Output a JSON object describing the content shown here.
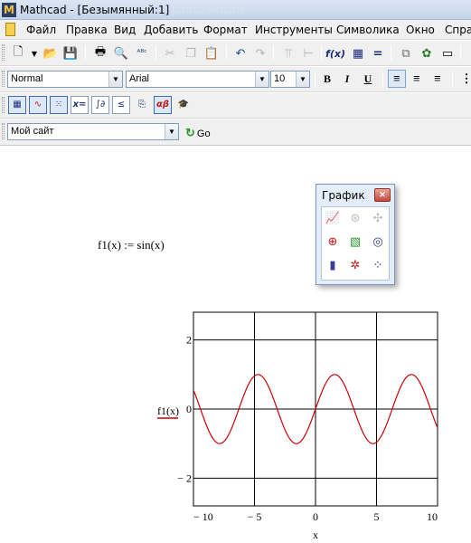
{
  "window": {
    "app_icon_letter": "M",
    "title": "Mathcad - [Безымянный:1]",
    "title_ghost": "Jumaz Amam"
  },
  "menu": {
    "items": [
      "Файл",
      "Правка",
      "Вид",
      "Добавить",
      "Формат",
      "Инструменты",
      "Символика",
      "Окно",
      "Справ"
    ]
  },
  "toolbar_standard": {
    "icons": [
      "new-document",
      "dropdown-arrow",
      "open-folder",
      "save",
      "print",
      "print-preview",
      "spell-check",
      "cut",
      "copy",
      "paste",
      "undo",
      "redo",
      "align-vertical",
      "align-horizontal",
      "insert-function",
      "insert-unit",
      "calculate",
      "resource-center",
      "component-wizard",
      "window"
    ]
  },
  "toolbar_format": {
    "style": "Normal",
    "font": "Arial",
    "size": "10",
    "bold": "B",
    "italic": "I",
    "underline": "U"
  },
  "toolbar_math": {
    "buttons": [
      "calculator",
      "graph",
      "matrix",
      "x=",
      "calculus",
      "boolean",
      "programming",
      "αβ",
      "symbolic"
    ]
  },
  "toolbar_resources": {
    "site": "Мой сайт",
    "go_label": "Go"
  },
  "worksheet": {
    "formula": "f1(x) := sin(x)"
  },
  "graph_palette": {
    "title": "График",
    "buttons": [
      "xy-plot",
      "polar-plot",
      "surface-plot",
      "contour-plot",
      "3d-scatter",
      "vector-field",
      "bar-3d",
      "scatter-3d",
      "patch-plot"
    ]
  },
  "chart_data": {
    "type": "line",
    "function": "sin(x)",
    "series": [
      {
        "name": "f1(x)",
        "color": "#cc0000"
      }
    ],
    "xlabel": "x",
    "ylabel": "f1(x)",
    "xlim": [
      -10,
      10
    ],
    "ylim": [
      -2.8,
      2.8
    ],
    "x_ticks": [
      -10,
      -5,
      0,
      5,
      10
    ],
    "x_tick_labels": [
      "− 10",
      "− 5",
      "0",
      "5",
      "10"
    ],
    "y_ticks": [
      2,
      0,
      -2
    ],
    "y_tick_labels": [
      "2",
      "0",
      "− 2"
    ],
    "grid": true
  }
}
